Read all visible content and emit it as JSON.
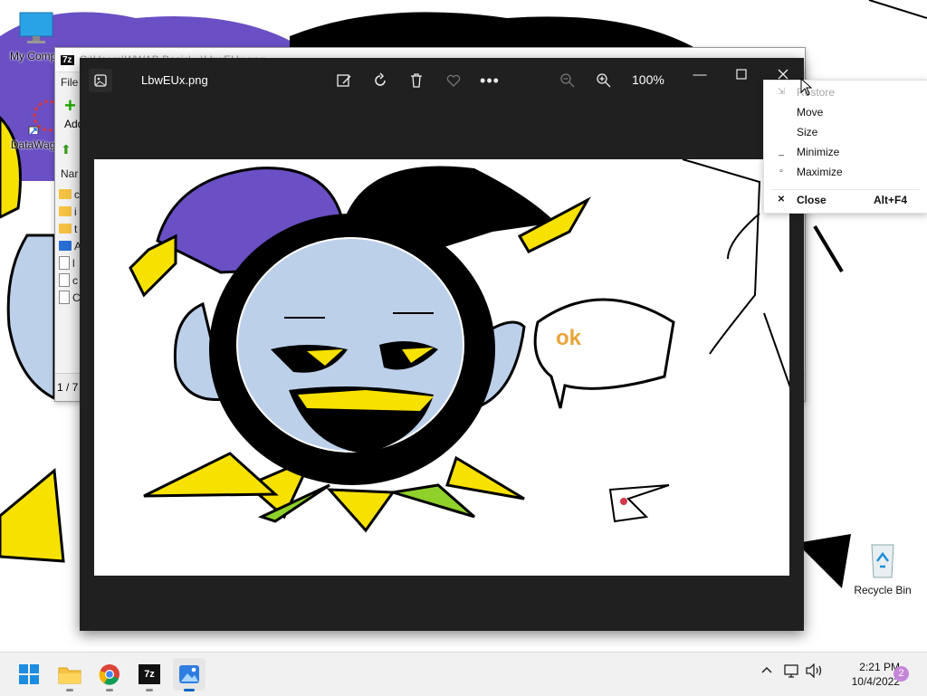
{
  "desktop": {
    "icons": [
      {
        "label": "My Compu",
        "icon": "monitor-icon"
      },
      {
        "label": "DataWago",
        "icon": "datawagon-shortcut-icon"
      },
      {
        "label": "Recycle Bin",
        "icon": "recycle-bin-icon"
      }
    ]
  },
  "background_window": {
    "app_icon": "7z",
    "title": "C:\\Users\\WWAB Basic\\...\\LbwEUx.png",
    "menu_first": "File",
    "toolbar_add": "Add",
    "column_header": "Nar",
    "list_items": [
      {
        "type": "folder",
        "text": "c"
      },
      {
        "type": "folder",
        "text": "i"
      },
      {
        "type": "folder",
        "text": "t"
      },
      {
        "type": "image",
        "text": "A"
      },
      {
        "type": "file",
        "text": "l"
      },
      {
        "type": "file",
        "text": "c"
      },
      {
        "type": "file",
        "text": "C"
      }
    ],
    "status": "1 / 7"
  },
  "photos": {
    "file_name": "LbwEUx.png",
    "zoom": "100%",
    "toolbar": [
      "edit-image-icon",
      "rotate-icon",
      "delete-icon",
      "favorite-heart-icon",
      "more-options-icon",
      "zoom-out-icon",
      "zoom-in-icon"
    ],
    "image_text": "ok"
  },
  "context_menu": {
    "items": [
      {
        "label": "Restore",
        "icon": "restore-icon",
        "disabled": true
      },
      {
        "label": "Move",
        "disabled": false
      },
      {
        "label": "Size",
        "disabled": false
      },
      {
        "label": "Minimize",
        "icon": "minimize-glyph-icon",
        "disabled": false
      },
      {
        "label": "Maximize",
        "icon": "maximize-glyph-icon",
        "disabled": false
      },
      {
        "label": "Close",
        "shortcut": "Alt+F4",
        "icon": "close-glyph-icon",
        "disabled": false
      }
    ]
  },
  "taskbar": {
    "apps": [
      "start-icon",
      "file-explorer-icon",
      "chrome-icon",
      "7zip-icon",
      "photos-icon"
    ],
    "tray": [
      "chevron-up-icon",
      "network-icon",
      "volume-icon"
    ],
    "time": "2:21 PM",
    "date": "10/4/2022",
    "notification_count": "2"
  },
  "colors": {
    "photos_bg": "#202020",
    "jester_purple": "#6b4fc4",
    "jester_yellow": "#f7e100",
    "jester_face": "#bdd0ea",
    "jester_green": "#8fd12a"
  }
}
